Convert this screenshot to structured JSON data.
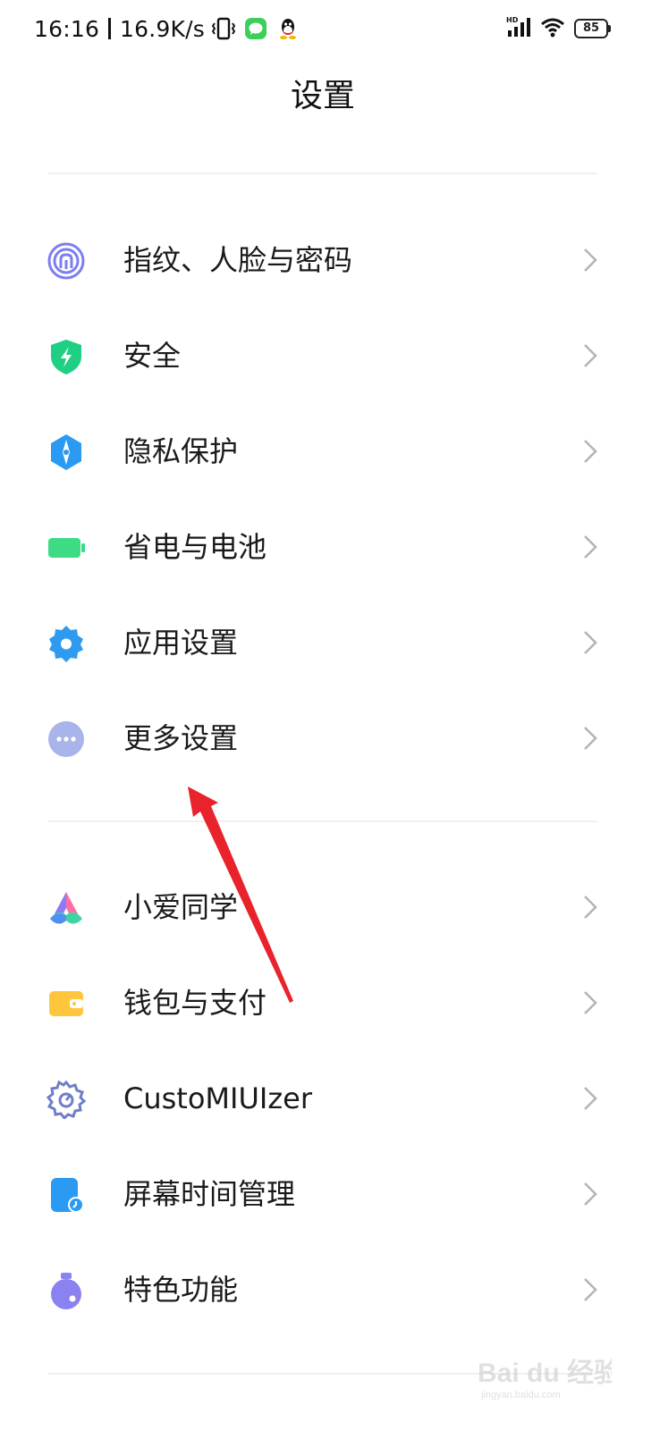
{
  "status_bar": {
    "time": "16:16",
    "speed": "16.9K/s",
    "battery": "85",
    "icons": [
      "vibrate-icon",
      "message-icon",
      "qq-icon",
      "hd-signal-icon",
      "wifi-icon",
      "battery-icon"
    ]
  },
  "header": {
    "title": "设置"
  },
  "groups": [
    {
      "items": [
        {
          "label": "指纹、人脸与密码",
          "icon": "fingerprint-icon",
          "color": "#7b7ff0"
        },
        {
          "label": "安全",
          "icon": "security-shield-icon",
          "color": "#1fcf83"
        },
        {
          "label": "隐私保护",
          "icon": "privacy-icon",
          "color": "#2b9af3"
        },
        {
          "label": "省电与电池",
          "icon": "battery-icon",
          "color": "#3ddc84"
        },
        {
          "label": "应用设置",
          "icon": "gear-icon",
          "color": "#2f9bf0"
        },
        {
          "label": "更多设置",
          "icon": "more-icon",
          "color": "#a8b4ea"
        }
      ]
    },
    {
      "items": [
        {
          "label": "小爱同学",
          "icon": "xiaoai-icon",
          "color": "#5b8cf7"
        },
        {
          "label": "钱包与支付",
          "icon": "wallet-icon",
          "color": "#ffc53d"
        },
        {
          "label": "CustoMIUIzer",
          "icon": "cog-outline-icon",
          "color": "#6f7fc7"
        },
        {
          "label": "屏幕时间管理",
          "icon": "screen-time-icon",
          "color": "#2b9af3"
        },
        {
          "label": "特色功能",
          "icon": "feature-icon",
          "color": "#8b82f2"
        }
      ]
    }
  ],
  "annotation": {
    "type": "arrow",
    "color": "#e8232b"
  },
  "watermark": {
    "text": "Bai du 经验",
    "subtext": "jingyan.baidu.com"
  }
}
